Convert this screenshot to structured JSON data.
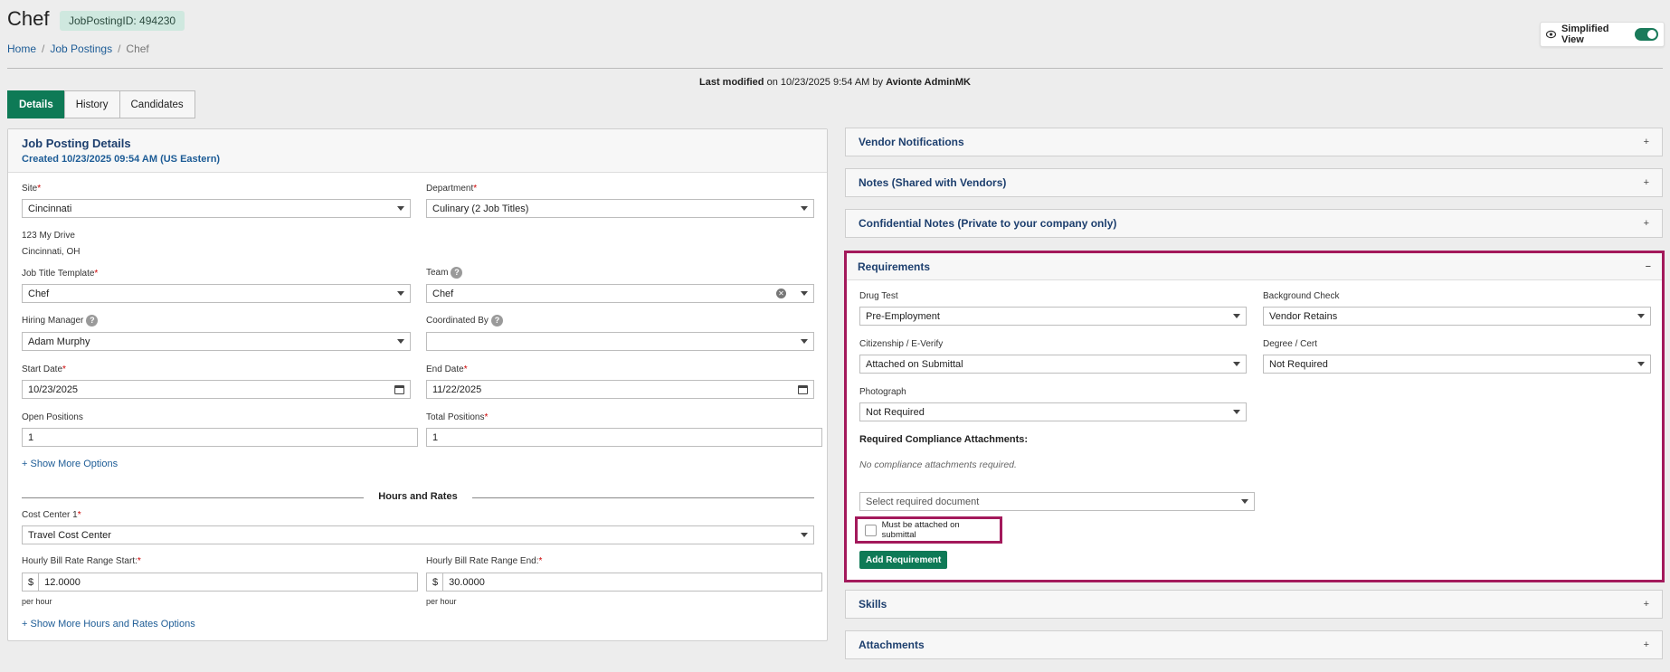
{
  "header": {
    "title": "Chef",
    "posting_id": "JobPostingID: 494230",
    "breadcrumb": [
      "Home",
      "Job Postings",
      "Chef"
    ],
    "simplified_view_label": "Simplified View",
    "simplified_view_on": true
  },
  "last_modified": {
    "prefix": "Last modified",
    "text": "on 10/23/2025 9:54 AM by",
    "user": "Avionte AdminMK"
  },
  "tabs": [
    {
      "label": "Details",
      "active": true
    },
    {
      "label": "History",
      "active": false
    },
    {
      "label": "Candidates",
      "active": false
    }
  ],
  "details": {
    "title": "Job Posting Details",
    "created": "Created 10/23/2025 09:54 AM (US Eastern)",
    "site": {
      "label": "Site",
      "value": "Cincinnati"
    },
    "address": [
      "123 My Drive",
      "Cincinnati, OH"
    ],
    "department": {
      "label": "Department",
      "value": "Culinary (2 Job Titles)"
    },
    "job_title_template": {
      "label": "Job Title Template",
      "value": "Chef"
    },
    "team": {
      "label": "Team",
      "value": "Chef"
    },
    "hiring_manager": {
      "label": "Hiring Manager",
      "value": "Adam Murphy"
    },
    "coordinated_by": {
      "label": "Coordinated By",
      "value": ""
    },
    "start_date": {
      "label": "Start Date",
      "value": "10/23/2025"
    },
    "end_date": {
      "label": "End Date",
      "value": "11/22/2025"
    },
    "open_positions": {
      "label": "Open Positions",
      "value": "1"
    },
    "total_positions": {
      "label": "Total Positions",
      "value": "1"
    },
    "show_more": "Show More Options",
    "hours_rates_title": "Hours and Rates",
    "cost_center": {
      "label": "Cost Center 1",
      "value": "Travel Cost Center"
    },
    "bill_start": {
      "label": "Hourly Bill Rate Range Start:",
      "prefix": "$",
      "value": "12.0000",
      "unit": "per hour"
    },
    "bill_end": {
      "label": "Hourly Bill Rate Range End:",
      "prefix": "$",
      "value": "30.0000",
      "unit": "per hour"
    },
    "show_more_rates": "Show More Hours and Rates Options",
    "required_mark": "*",
    "help_glyph": "?",
    "plus_glyph": "+"
  },
  "accordions": {
    "vendor_notifications": "Vendor Notifications",
    "notes_shared": "Notes (Shared with Vendors)",
    "confidential_notes": "Confidential Notes (Private to your company only)",
    "skills": "Skills",
    "attachments": "Attachments",
    "expand_glyph": "+",
    "collapse_glyph": "−"
  },
  "requirements": {
    "title": "Requirements",
    "drug_test": {
      "label": "Drug Test",
      "value": "Pre-Employment"
    },
    "background_check": {
      "label": "Background Check",
      "value": "Vendor Retains"
    },
    "citizenship": {
      "label": "Citizenship / E-Verify",
      "value": "Attached on Submittal"
    },
    "degree": {
      "label": "Degree / Cert",
      "value": "Not Required"
    },
    "photograph": {
      "label": "Photograph",
      "value": "Not Required"
    },
    "compliance_title": "Required Compliance Attachments:",
    "compliance_empty": "No compliance attachments required.",
    "select_doc_placeholder": "Select required document",
    "must_attach_label": "Must be attached on submittal",
    "must_attach_checked": false,
    "add_button": "Add Requirement"
  },
  "colors": {
    "primary_green": "#0e7a56",
    "highlight": "#a3195b",
    "link": "#1d5c96",
    "heading": "#1d3f6e"
  }
}
